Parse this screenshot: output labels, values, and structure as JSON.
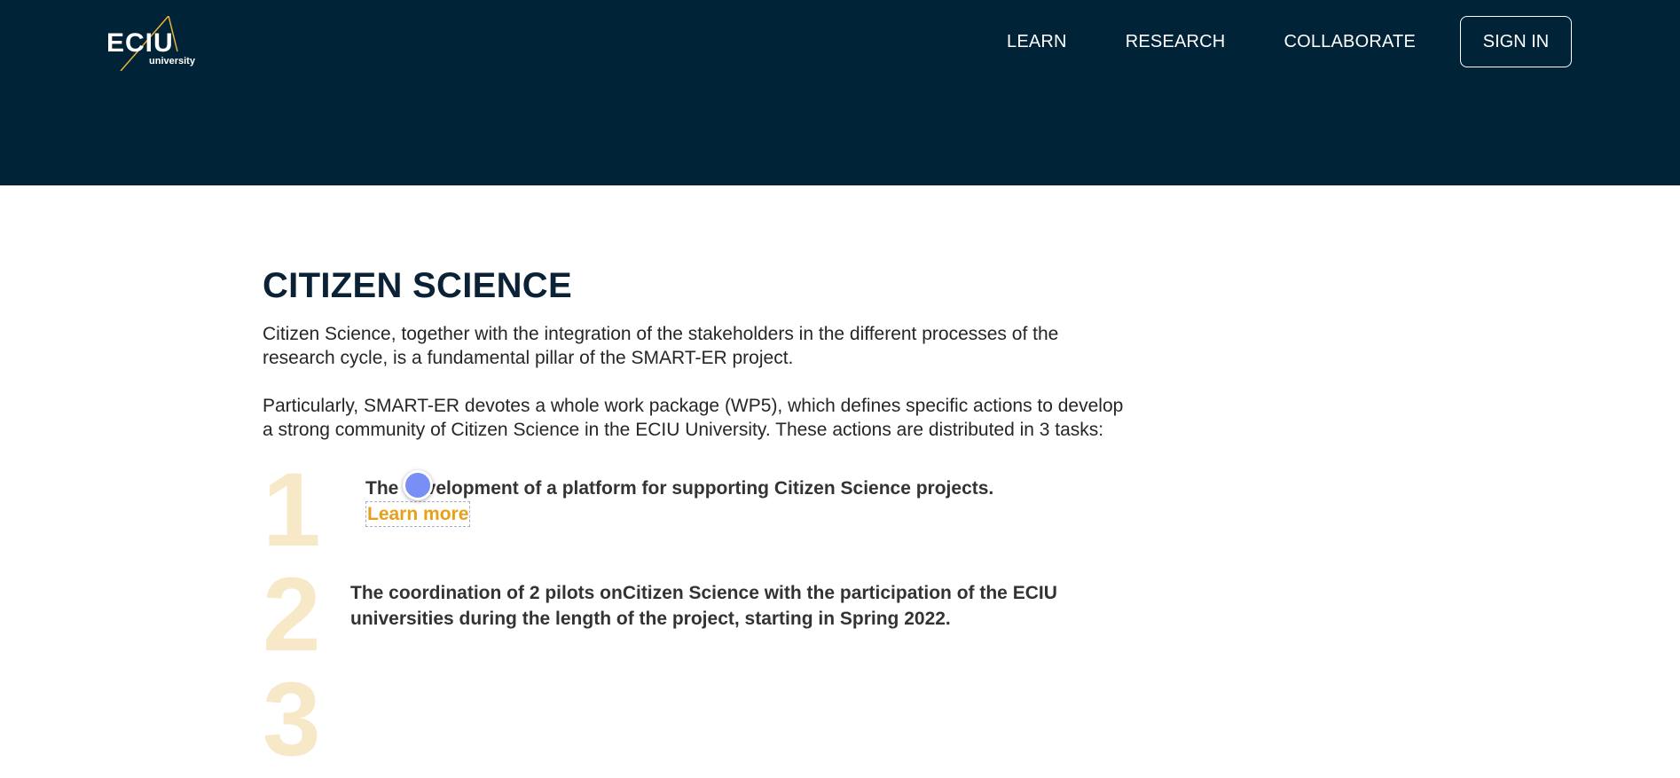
{
  "header": {
    "logo": {
      "word": "ECIU",
      "sub": "university",
      "accent": "#e8b339"
    },
    "nav": [
      "LEARN",
      "RESEARCH",
      "COLLABORATE"
    ],
    "signin_label": "SIGN IN",
    "bg": "#012337"
  },
  "main": {
    "title": "CITIZEN SCIENCE",
    "paragraphs": [
      "Citizen Science, together with the integration of the stakeholders in the different processes of the research cycle, is a fundamental pillar of the SMART-ER project.",
      "Particularly, SMART-ER devotes a whole work package (WP5), which defines specific actions to develop a strong community of Citizen Science in the ECIU University. These actions are distributed in 3 tasks:"
    ],
    "tasks": [
      {
        "number": "1",
        "text": "The development of a platform for supporting Citizen Science projects.",
        "link": "Learn more"
      },
      {
        "number": "2",
        "text": "The coordination of 2 pilots onCitizen Science with the participation of the ECIU universities during the length of the project, starting in Spring 2022."
      },
      {
        "number": "3"
      }
    ],
    "accent": "#e8a018",
    "number_color": "#f7e9c8"
  }
}
